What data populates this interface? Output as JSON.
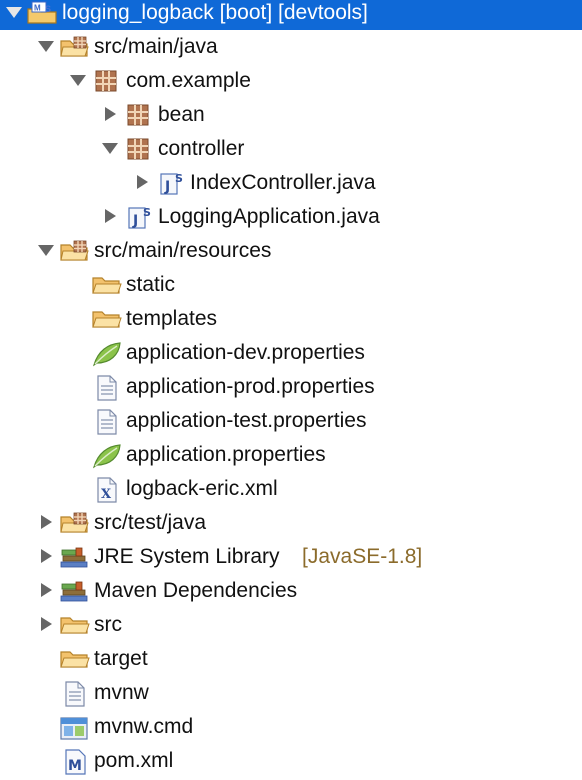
{
  "tree": {
    "items": [
      {
        "label": "logging_logback [boot] [devtools]",
        "icon": "project-icon",
        "expanded": true,
        "selected": true
      },
      {
        "label": "src/main/java",
        "icon": "source-folder-icon",
        "expanded": true
      },
      {
        "label": "com.example",
        "icon": "package-icon",
        "expanded": true
      },
      {
        "label": "bean",
        "icon": "package-icon",
        "expanded": false
      },
      {
        "label": "controller",
        "icon": "package-icon",
        "expanded": true
      },
      {
        "label": "IndexController.java",
        "icon": "spring-java-file-icon",
        "expanded": false
      },
      {
        "label": "LoggingApplication.java",
        "icon": "spring-java-file-icon",
        "expanded": false
      },
      {
        "label": "src/main/resources",
        "icon": "source-folder-icon",
        "expanded": true
      },
      {
        "label": "static",
        "icon": "folder-icon"
      },
      {
        "label": "templates",
        "icon": "folder-icon"
      },
      {
        "label": "application-dev.properties",
        "icon": "spring-leaf-icon"
      },
      {
        "label": "application-prod.properties",
        "icon": "text-file-icon"
      },
      {
        "label": "application-test.properties",
        "icon": "text-file-icon"
      },
      {
        "label": "application.properties",
        "icon": "spring-leaf-icon"
      },
      {
        "label": "logback-eric.xml",
        "icon": "xml-file-icon"
      },
      {
        "label": "src/test/java",
        "icon": "source-folder-icon",
        "expanded": false
      },
      {
        "label": "JRE System Library",
        "icon": "library-icon",
        "decoration": "[JavaSE-1.8]",
        "expanded": false
      },
      {
        "label": "Maven Dependencies",
        "icon": "library-icon",
        "expanded": false
      },
      {
        "label": "src",
        "icon": "folder-icon",
        "expanded": false
      },
      {
        "label": "target",
        "icon": "folder-icon"
      },
      {
        "label": "mvnw",
        "icon": "text-file-icon"
      },
      {
        "label": "mvnw.cmd",
        "icon": "windows-script-icon"
      },
      {
        "label": "pom.xml",
        "icon": "maven-pom-icon"
      }
    ]
  },
  "colors": {
    "selection": "#0f69d7",
    "decoration": "#8b6b2b",
    "twisty": "#666666"
  }
}
